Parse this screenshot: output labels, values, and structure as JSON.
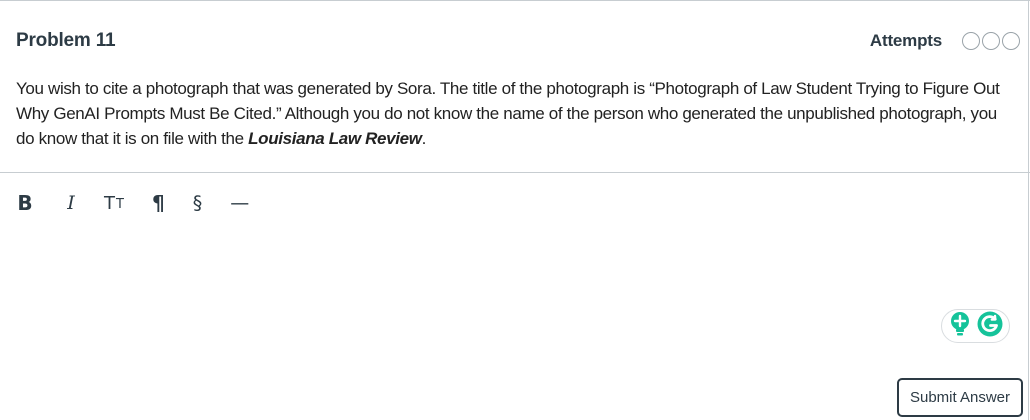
{
  "problem": {
    "title": "Problem 11",
    "attempts_label": "Attempts",
    "attempts_total": 3,
    "attempts_used": 0
  },
  "question": {
    "part1": "You wish to cite a photograph that was generated by Sora. The title of the photograph is “Photograph of Law Student Trying to Figure Out Why GenAI Prompts Must Be Cited.” Although you do not know the name of the person who generated the unpublished photograph, you do know that it is on file with the ",
    "italic": "Louisiana Law Review",
    "part2": "."
  },
  "toolbar": {
    "bold": "B",
    "italic": "I",
    "text_size_large": "T",
    "text_size_small": "T",
    "paragraph": "¶",
    "section": "§",
    "dash": "—"
  },
  "editor": {
    "value": ""
  },
  "grammarly": {
    "icons": [
      "lightbulb-icon",
      "grammarly-g-icon"
    ],
    "colors": {
      "bulb": "#15c39a",
      "g": "#15c39a"
    }
  },
  "submit": {
    "label": "Submit Answer"
  }
}
